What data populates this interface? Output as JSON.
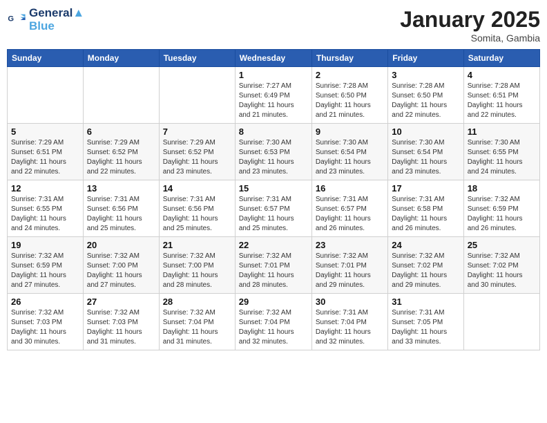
{
  "logo": {
    "line1": "General",
    "line2": "Blue"
  },
  "title": "January 2025",
  "location": "Somita, Gambia",
  "days_header": [
    "Sunday",
    "Monday",
    "Tuesday",
    "Wednesday",
    "Thursday",
    "Friday",
    "Saturday"
  ],
  "weeks": [
    [
      {
        "day": "",
        "info": ""
      },
      {
        "day": "",
        "info": ""
      },
      {
        "day": "",
        "info": ""
      },
      {
        "day": "1",
        "info": "Sunrise: 7:27 AM\nSunset: 6:49 PM\nDaylight: 11 hours\nand 21 minutes."
      },
      {
        "day": "2",
        "info": "Sunrise: 7:28 AM\nSunset: 6:50 PM\nDaylight: 11 hours\nand 21 minutes."
      },
      {
        "day": "3",
        "info": "Sunrise: 7:28 AM\nSunset: 6:50 PM\nDaylight: 11 hours\nand 22 minutes."
      },
      {
        "day": "4",
        "info": "Sunrise: 7:28 AM\nSunset: 6:51 PM\nDaylight: 11 hours\nand 22 minutes."
      }
    ],
    [
      {
        "day": "5",
        "info": "Sunrise: 7:29 AM\nSunset: 6:51 PM\nDaylight: 11 hours\nand 22 minutes."
      },
      {
        "day": "6",
        "info": "Sunrise: 7:29 AM\nSunset: 6:52 PM\nDaylight: 11 hours\nand 22 minutes."
      },
      {
        "day": "7",
        "info": "Sunrise: 7:29 AM\nSunset: 6:52 PM\nDaylight: 11 hours\nand 23 minutes."
      },
      {
        "day": "8",
        "info": "Sunrise: 7:30 AM\nSunset: 6:53 PM\nDaylight: 11 hours\nand 23 minutes."
      },
      {
        "day": "9",
        "info": "Sunrise: 7:30 AM\nSunset: 6:54 PM\nDaylight: 11 hours\nand 23 minutes."
      },
      {
        "day": "10",
        "info": "Sunrise: 7:30 AM\nSunset: 6:54 PM\nDaylight: 11 hours\nand 23 minutes."
      },
      {
        "day": "11",
        "info": "Sunrise: 7:30 AM\nSunset: 6:55 PM\nDaylight: 11 hours\nand 24 minutes."
      }
    ],
    [
      {
        "day": "12",
        "info": "Sunrise: 7:31 AM\nSunset: 6:55 PM\nDaylight: 11 hours\nand 24 minutes."
      },
      {
        "day": "13",
        "info": "Sunrise: 7:31 AM\nSunset: 6:56 PM\nDaylight: 11 hours\nand 25 minutes."
      },
      {
        "day": "14",
        "info": "Sunrise: 7:31 AM\nSunset: 6:56 PM\nDaylight: 11 hours\nand 25 minutes."
      },
      {
        "day": "15",
        "info": "Sunrise: 7:31 AM\nSunset: 6:57 PM\nDaylight: 11 hours\nand 25 minutes."
      },
      {
        "day": "16",
        "info": "Sunrise: 7:31 AM\nSunset: 6:57 PM\nDaylight: 11 hours\nand 26 minutes."
      },
      {
        "day": "17",
        "info": "Sunrise: 7:31 AM\nSunset: 6:58 PM\nDaylight: 11 hours\nand 26 minutes."
      },
      {
        "day": "18",
        "info": "Sunrise: 7:32 AM\nSunset: 6:59 PM\nDaylight: 11 hours\nand 26 minutes."
      }
    ],
    [
      {
        "day": "19",
        "info": "Sunrise: 7:32 AM\nSunset: 6:59 PM\nDaylight: 11 hours\nand 27 minutes."
      },
      {
        "day": "20",
        "info": "Sunrise: 7:32 AM\nSunset: 7:00 PM\nDaylight: 11 hours\nand 27 minutes."
      },
      {
        "day": "21",
        "info": "Sunrise: 7:32 AM\nSunset: 7:00 PM\nDaylight: 11 hours\nand 28 minutes."
      },
      {
        "day": "22",
        "info": "Sunrise: 7:32 AM\nSunset: 7:01 PM\nDaylight: 11 hours\nand 28 minutes."
      },
      {
        "day": "23",
        "info": "Sunrise: 7:32 AM\nSunset: 7:01 PM\nDaylight: 11 hours\nand 29 minutes."
      },
      {
        "day": "24",
        "info": "Sunrise: 7:32 AM\nSunset: 7:02 PM\nDaylight: 11 hours\nand 29 minutes."
      },
      {
        "day": "25",
        "info": "Sunrise: 7:32 AM\nSunset: 7:02 PM\nDaylight: 11 hours\nand 30 minutes."
      }
    ],
    [
      {
        "day": "26",
        "info": "Sunrise: 7:32 AM\nSunset: 7:03 PM\nDaylight: 11 hours\nand 30 minutes."
      },
      {
        "day": "27",
        "info": "Sunrise: 7:32 AM\nSunset: 7:03 PM\nDaylight: 11 hours\nand 31 minutes."
      },
      {
        "day": "28",
        "info": "Sunrise: 7:32 AM\nSunset: 7:04 PM\nDaylight: 11 hours\nand 31 minutes."
      },
      {
        "day": "29",
        "info": "Sunrise: 7:32 AM\nSunset: 7:04 PM\nDaylight: 11 hours\nand 32 minutes."
      },
      {
        "day": "30",
        "info": "Sunrise: 7:31 AM\nSunset: 7:04 PM\nDaylight: 11 hours\nand 32 minutes."
      },
      {
        "day": "31",
        "info": "Sunrise: 7:31 AM\nSunset: 7:05 PM\nDaylight: 11 hours\nand 33 minutes."
      },
      {
        "day": "",
        "info": ""
      }
    ]
  ]
}
